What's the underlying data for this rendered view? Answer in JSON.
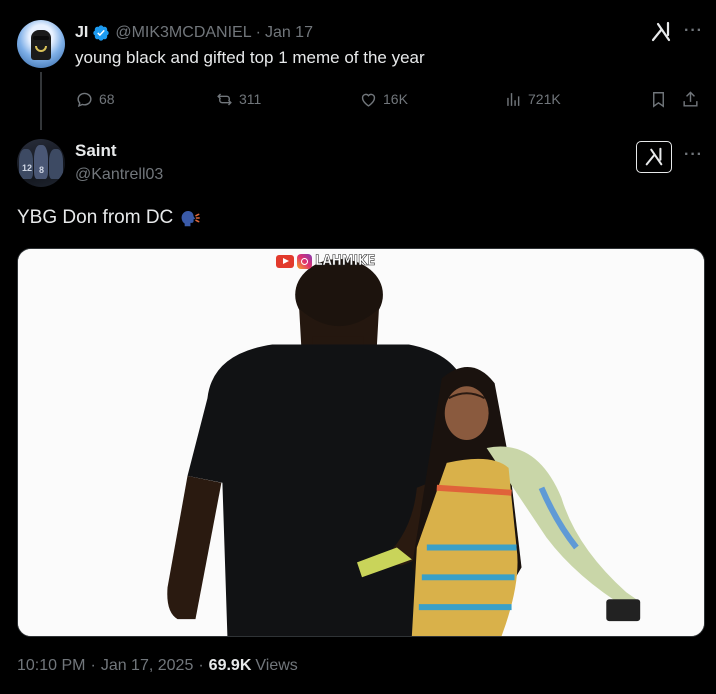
{
  "parent_tweet": {
    "display_name": "JI",
    "handle": "@MIK3MCDANIEL",
    "separator": "·",
    "date": "Jan 17",
    "text": "young black and gifted top 1 meme of the year",
    "stats": {
      "replies": "68",
      "reposts": "311",
      "likes": "16K",
      "views": "721K"
    },
    "more_label": "···"
  },
  "main_tweet": {
    "display_name": "Saint",
    "handle": "@Kantrell03",
    "text": "YBG Don from DC",
    "more_label": "···",
    "media": {
      "watermark": "LAHMIKE"
    },
    "footer": {
      "time": "10:10 PM",
      "sep1": "·",
      "date": "Jan 17, 2025",
      "sep2": "·",
      "views_count": "69.9K",
      "views_label": "Views"
    }
  },
  "colors": {
    "background": "#000000",
    "text_primary": "#e7e9ea",
    "text_secondary": "#71767b",
    "verified_blue": "#1d9bf0"
  },
  "icons": [
    "reply-icon",
    "repost-icon",
    "like-icon",
    "views-icon",
    "bookmark-icon",
    "share-icon",
    "grok-icon",
    "verified-icon",
    "speaking-head-icon"
  ]
}
